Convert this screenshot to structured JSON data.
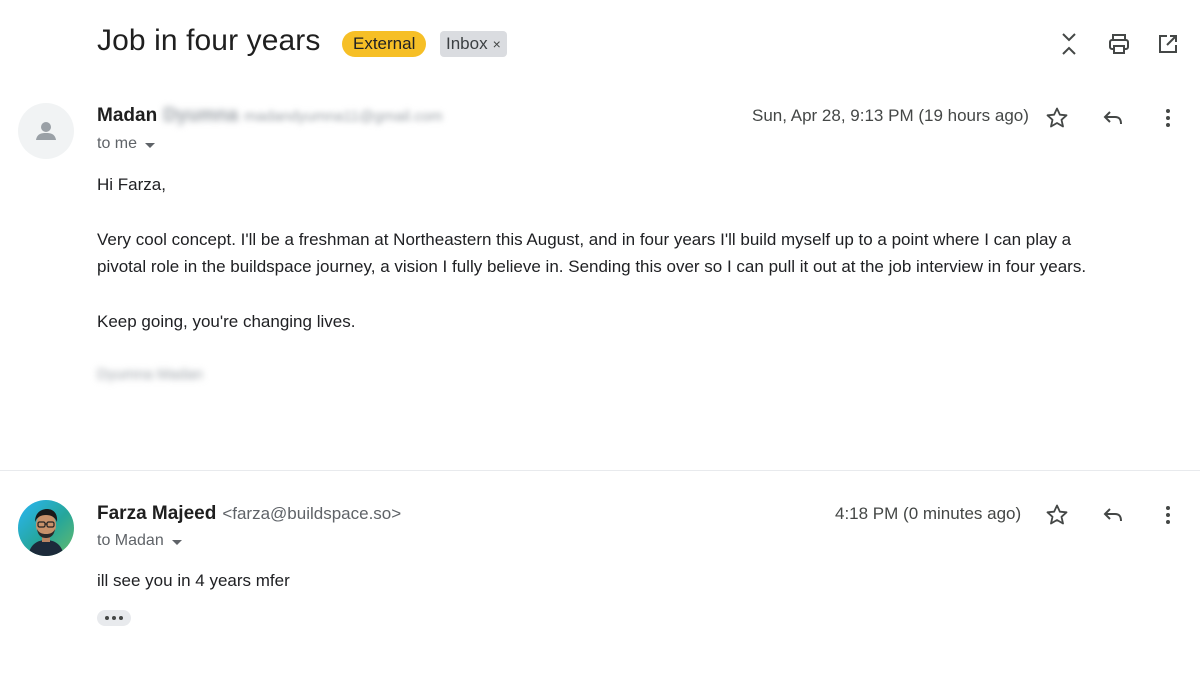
{
  "thread": {
    "subject": "Job in four years",
    "labels": {
      "external": "External",
      "inbox": "Inbox",
      "remove_glyph": "×"
    },
    "toolbar_icons": [
      "collapse-all-icon",
      "print-icon",
      "open-new-window-icon"
    ]
  },
  "messages": [
    {
      "sender_first": "Madan",
      "sender_last_blurred": "Dyumna",
      "sender_email_blurred": "madandyumna11@gmail.com",
      "to": "to me",
      "date": "Sun, Apr 28, 9:13 PM (19 hours ago)",
      "body": [
        "Hi Farza,",
        "Very cool concept. I'll be a freshman at Northeastern this August, and in four years I'll build myself up to a point where I can play a",
        "pivotal role in the buildspace journey, a vision I fully believe in. Sending this over so I can pull it out at the job interview in four years.",
        "Keep going, you're changing lives."
      ],
      "signature_blurred": "Dyumna Madan"
    },
    {
      "sender": "Farza Majeed",
      "email": "<farza@buildspace.so>",
      "to": "to Madan",
      "date": "4:18 PM (0 minutes ago)",
      "body": [
        "ill see you in 4 years mfer"
      ]
    }
  ],
  "colors": {
    "external_label": "#f6bf26",
    "inbox_label": "#dadce0",
    "text": "#202124",
    "muted": "#5f6368"
  }
}
